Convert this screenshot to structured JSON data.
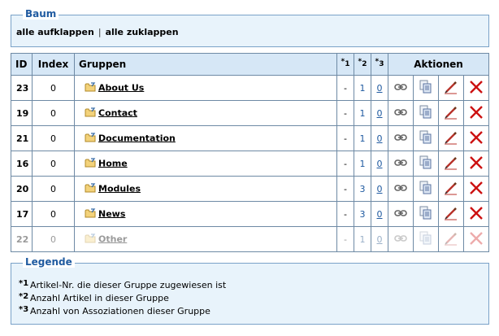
{
  "tree": {
    "legend": "Baum",
    "expand_all": "alle aufklappen",
    "separator": "|",
    "collapse_all": "alle zuklappen"
  },
  "table": {
    "headers": {
      "id": "ID",
      "index": "Index",
      "groups": "Gruppen",
      "star1": "1",
      "star2": "2",
      "star3": "3",
      "actions": "Aktionen"
    },
    "rows": [
      {
        "id": "23",
        "index": "0",
        "name": "About Us",
        "c1": "-",
        "c2": "1",
        "c3": "0"
      },
      {
        "id": "19",
        "index": "0",
        "name": "Contact",
        "c1": "-",
        "c2": "1",
        "c3": "0"
      },
      {
        "id": "21",
        "index": "0",
        "name": "Documentation",
        "c1": "-",
        "c2": "1",
        "c3": "0"
      },
      {
        "id": "16",
        "index": "0",
        "name": "Home",
        "c1": "-",
        "c2": "1",
        "c3": "0"
      },
      {
        "id": "20",
        "index": "0",
        "name": "Modules",
        "c1": "-",
        "c2": "3",
        "c3": "0"
      },
      {
        "id": "17",
        "index": "0",
        "name": "News",
        "c1": "-",
        "c2": "3",
        "c3": "0"
      },
      {
        "id": "22",
        "index": "0",
        "name": "Other",
        "c1": "-",
        "c2": "1",
        "c3": "0"
      }
    ]
  },
  "legend": {
    "title": "Legende",
    "items": [
      {
        "mark": "1",
        "text": "Artikel-Nr. die dieser Gruppe zugewiesen ist"
      },
      {
        "mark": "2",
        "text": "Anzahl Artikel in dieser Gruppe"
      },
      {
        "mark": "3",
        "text": "Anzahl von Assoziationen dieser Gruppe"
      }
    ]
  },
  "colors": {
    "header_bg": "#d6e7f6",
    "box_bg": "#e8f3fb",
    "accent": "#1f5aa0",
    "delete": "#cc1111"
  }
}
